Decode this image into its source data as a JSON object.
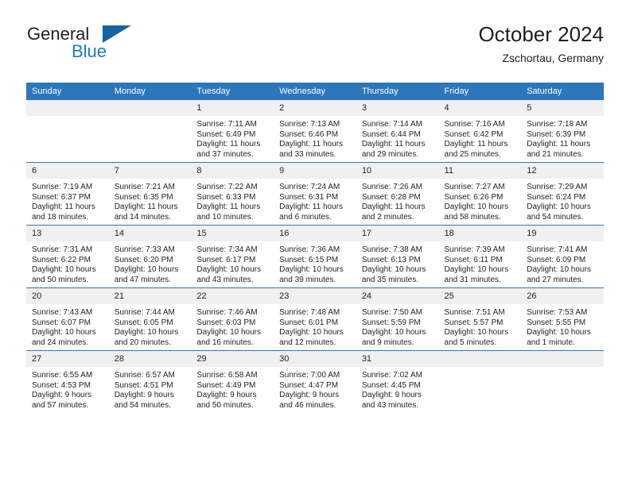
{
  "brand": {
    "name_part1": "General",
    "name_part2": "Blue",
    "accent_color": "#1464a5",
    "logo_icon": "triangle-icon"
  },
  "header": {
    "title": "October 2024",
    "subtitle": "Zschortau, Germany"
  },
  "calendar": {
    "header_bg": "#2c76bc",
    "daynum_bg": "#f0f0f0",
    "weekday_headers": [
      "Sunday",
      "Monday",
      "Tuesday",
      "Wednesday",
      "Thursday",
      "Friday",
      "Saturday"
    ],
    "weeks": [
      [
        {
          "day": "",
          "lines": []
        },
        {
          "day": "",
          "lines": []
        },
        {
          "day": "1",
          "lines": [
            "Sunrise: 7:11 AM",
            "Sunset: 6:49 PM",
            "Daylight: 11 hours",
            "and 37 minutes."
          ]
        },
        {
          "day": "2",
          "lines": [
            "Sunrise: 7:13 AM",
            "Sunset: 6:46 PM",
            "Daylight: 11 hours",
            "and 33 minutes."
          ]
        },
        {
          "day": "3",
          "lines": [
            "Sunrise: 7:14 AM",
            "Sunset: 6:44 PM",
            "Daylight: 11 hours",
            "and 29 minutes."
          ]
        },
        {
          "day": "4",
          "lines": [
            "Sunrise: 7:16 AM",
            "Sunset: 6:42 PM",
            "Daylight: 11 hours",
            "and 25 minutes."
          ]
        },
        {
          "day": "5",
          "lines": [
            "Sunrise: 7:18 AM",
            "Sunset: 6:39 PM",
            "Daylight: 11 hours",
            "and 21 minutes."
          ]
        }
      ],
      [
        {
          "day": "6",
          "lines": [
            "Sunrise: 7:19 AM",
            "Sunset: 6:37 PM",
            "Daylight: 11 hours",
            "and 18 minutes."
          ]
        },
        {
          "day": "7",
          "lines": [
            "Sunrise: 7:21 AM",
            "Sunset: 6:35 PM",
            "Daylight: 11 hours",
            "and 14 minutes."
          ]
        },
        {
          "day": "8",
          "lines": [
            "Sunrise: 7:22 AM",
            "Sunset: 6:33 PM",
            "Daylight: 11 hours",
            "and 10 minutes."
          ]
        },
        {
          "day": "9",
          "lines": [
            "Sunrise: 7:24 AM",
            "Sunset: 6:31 PM",
            "Daylight: 11 hours",
            "and 6 minutes."
          ]
        },
        {
          "day": "10",
          "lines": [
            "Sunrise: 7:26 AM",
            "Sunset: 6:28 PM",
            "Daylight: 11 hours",
            "and 2 minutes."
          ]
        },
        {
          "day": "11",
          "lines": [
            "Sunrise: 7:27 AM",
            "Sunset: 6:26 PM",
            "Daylight: 10 hours",
            "and 58 minutes."
          ]
        },
        {
          "day": "12",
          "lines": [
            "Sunrise: 7:29 AM",
            "Sunset: 6:24 PM",
            "Daylight: 10 hours",
            "and 54 minutes."
          ]
        }
      ],
      [
        {
          "day": "13",
          "lines": [
            "Sunrise: 7:31 AM",
            "Sunset: 6:22 PM",
            "Daylight: 10 hours",
            "and 50 minutes."
          ]
        },
        {
          "day": "14",
          "lines": [
            "Sunrise: 7:33 AM",
            "Sunset: 6:20 PM",
            "Daylight: 10 hours",
            "and 47 minutes."
          ]
        },
        {
          "day": "15",
          "lines": [
            "Sunrise: 7:34 AM",
            "Sunset: 6:17 PM",
            "Daylight: 10 hours",
            "and 43 minutes."
          ]
        },
        {
          "day": "16",
          "lines": [
            "Sunrise: 7:36 AM",
            "Sunset: 6:15 PM",
            "Daylight: 10 hours",
            "and 39 minutes."
          ]
        },
        {
          "day": "17",
          "lines": [
            "Sunrise: 7:38 AM",
            "Sunset: 6:13 PM",
            "Daylight: 10 hours",
            "and 35 minutes."
          ]
        },
        {
          "day": "18",
          "lines": [
            "Sunrise: 7:39 AM",
            "Sunset: 6:11 PM",
            "Daylight: 10 hours",
            "and 31 minutes."
          ]
        },
        {
          "day": "19",
          "lines": [
            "Sunrise: 7:41 AM",
            "Sunset: 6:09 PM",
            "Daylight: 10 hours",
            "and 27 minutes."
          ]
        }
      ],
      [
        {
          "day": "20",
          "lines": [
            "Sunrise: 7:43 AM",
            "Sunset: 6:07 PM",
            "Daylight: 10 hours",
            "and 24 minutes."
          ]
        },
        {
          "day": "21",
          "lines": [
            "Sunrise: 7:44 AM",
            "Sunset: 6:05 PM",
            "Daylight: 10 hours",
            "and 20 minutes."
          ]
        },
        {
          "day": "22",
          "lines": [
            "Sunrise: 7:46 AM",
            "Sunset: 6:03 PM",
            "Daylight: 10 hours",
            "and 16 minutes."
          ]
        },
        {
          "day": "23",
          "lines": [
            "Sunrise: 7:48 AM",
            "Sunset: 6:01 PM",
            "Daylight: 10 hours",
            "and 12 minutes."
          ]
        },
        {
          "day": "24",
          "lines": [
            "Sunrise: 7:50 AM",
            "Sunset: 5:59 PM",
            "Daylight: 10 hours",
            "and 9 minutes."
          ]
        },
        {
          "day": "25",
          "lines": [
            "Sunrise: 7:51 AM",
            "Sunset: 5:57 PM",
            "Daylight: 10 hours",
            "and 5 minutes."
          ]
        },
        {
          "day": "26",
          "lines": [
            "Sunrise: 7:53 AM",
            "Sunset: 5:55 PM",
            "Daylight: 10 hours",
            "and 1 minute."
          ]
        }
      ],
      [
        {
          "day": "27",
          "lines": [
            "Sunrise: 6:55 AM",
            "Sunset: 4:53 PM",
            "Daylight: 9 hours",
            "and 57 minutes."
          ]
        },
        {
          "day": "28",
          "lines": [
            "Sunrise: 6:57 AM",
            "Sunset: 4:51 PM",
            "Daylight: 9 hours",
            "and 54 minutes."
          ]
        },
        {
          "day": "29",
          "lines": [
            "Sunrise: 6:58 AM",
            "Sunset: 4:49 PM",
            "Daylight: 9 hours",
            "and 50 minutes."
          ]
        },
        {
          "day": "30",
          "lines": [
            "Sunrise: 7:00 AM",
            "Sunset: 4:47 PM",
            "Daylight: 9 hours",
            "and 46 minutes."
          ]
        },
        {
          "day": "31",
          "lines": [
            "Sunrise: 7:02 AM",
            "Sunset: 4:45 PM",
            "Daylight: 9 hours",
            "and 43 minutes."
          ]
        },
        {
          "day": "",
          "lines": []
        },
        {
          "day": "",
          "lines": []
        }
      ]
    ]
  }
}
